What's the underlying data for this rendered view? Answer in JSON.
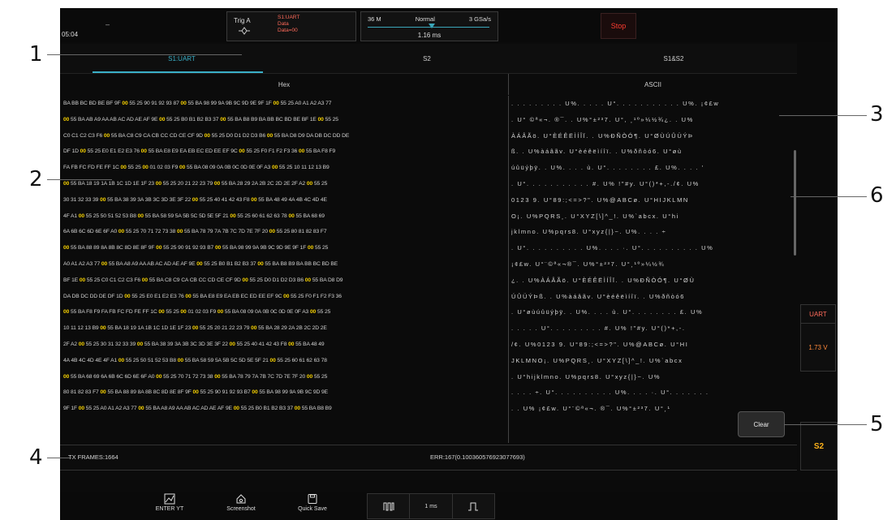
{
  "topbar": {
    "clock": "05:04",
    "left_symbol": "–",
    "trigger": {
      "label": "Trig A",
      "lines": [
        "S1:UART",
        "Data",
        "Data=00"
      ]
    },
    "acquisition": {
      "memory": "36 M",
      "mode": "Normal",
      "rate": "3 GSa/s",
      "timebase": "1.16 ms"
    },
    "stop_label": "Stop"
  },
  "tabs": [
    {
      "label": "S1:UART",
      "active": true
    },
    {
      "label": "S2",
      "active": false
    },
    {
      "label": "S1&S2",
      "active": false
    }
  ],
  "columns": {
    "hex": "Hex",
    "ascii": "ASCII"
  },
  "hex_rows": [
    "BA BB BC BD BE BF 9F 00 55 25 90 91 92 93 87 00 55 BA 98 99 9A 9B 9C 9D 9E 9F 1F 00 55 25 A0 A1 A2 A3 77",
    "00 55 BA AB A9 AA AB AC AD AE AF 9E 00 55 25 B0 B1 B2 B3 37 00 55 BA B8 B9 BA BB BC BD BE BF 1E 00 55 25",
    "C0 C1 C2 C3 F6 00 55 BA C8 C9 CA CB CC CD CE CF 9D 00 55 25 D0 D1 D2 D3 B6 00 55 BA D8 D9 DA DB DC DD DE",
    "DF 1D 00 55 25 E0 E1 E2 E3 76 00 55 BA E8 E9 EA EB EC ED EE EF 9C 00 55 25 F0 F1 F2 F3 36 00 55 BA F8 F9",
    "FA FB FC FD FE FF 1C 00 55 25 00 01 02 03 F9 00 55 BA 08 09 0A 0B 0C 0D 0E 0F A3 00 55 25 10 11 12 13 B9",
    "00 55 BA 18 19 1A 1B 1C 1D 1E 1F 23 00 55 25 20 21 22 23 79 00 55 BA 28 29 2A 2B 2C 2D 2E 2F A2 00 55 25",
    "30 31 32 33 39 00 55 BA 38 39 3A 3B 3C 3D 3E 3F 22 00 55 25 40 41 42 43 F8 00 55 BA 48 49 4A 4B 4C 4D 4E",
    "4F A1 00 55 25 50 51 52 53 B8 00 55 BA 58 59 5A 5B 5C 5D 5E 5F 21 00 55 25 60 61 62 63 78 00 55 BA 68 69",
    "6A 6B 6C 6D 6E 6F A0 00 55 25 70 71 72 73 38 00 55 BA 78 79 7A 7B 7C 7D 7E 7F 20 00 55 25 80 81 82 83 F7",
    "00 55 BA 88 89 8A 8B 8C 8D 8E 8F 9F 00 55 25 90 91 92 93 B7 00 55 BA 98 99 9A 9B 9C 9D 9E 9F 1F 00 55 25",
    "A0 A1 A2 A3 77 00 55 BA A8 A9 AA AB AC AD AE AF 9E 00 55 25 B0 B1 B2 B3 37 00 55 BA B8 B9 BA BB BC BD BE",
    "BF 1E 00 55 25 C0 C1 C2 C3 F6 00 55 BA C8 C9 CA CB CC CD CE CF 9D 00 55 25 D0 D1 D2 D3 B6 00 55 BA D8 D9",
    "DA DB DC DD DE DF 1D 00 55 25 E0 E1 E2 E3 76 00 55 BA E8 E9 EA EB EC ED EE EF 9C 00 55 25 F0 F1 F2 F3 36",
    "00 55 BA F8 F9 FA FB FC FD FE FF 1C 00 55 25 00 01 02 03 F9 00 55 BA 08 09 0A 0B 0C 0D 0E 0F A3 00 55 25",
    "10 11 12 13 B9 00 55 BA 18 19 1A 1B 1C 1D 1E 1F 23 00 55 25 20 21 22 23 79 00 55 BA 28 29 2A 2B 2C 2D 2E",
    "2F A2 00 55 25 30 31 32 33 39 00 55 BA 38 39 3A 3B 3C 3D 3E 3F 22 00 55 25 40 41 42 43 F8 00 55 BA 48 49",
    "4A 4B 4C 4D 4E 4F A1 00 55 25 50 51 52 53 B8 00 55 BA 58 59 5A 5B 5C 5D 5E 5F 21 00 55 25 60 61 62 63 78",
    "00 55 BA 68 69 6A 6B 6C 6D 6E 6F A0 00 55 25 70 71 72 73 38 00 55 BA 78 79 7A 7B 7C 7D 7E 7F 20 00 55 25",
    "80 81 82 83 F7 00 55 BA 88 89 8A 8B 8C 8D 8E 8F 9F 00 55 25 90 91 92 93 B7 00 55 BA 98 99 9A 9B 9C 9D 9E",
    "9F 1F 00 55 25 A0 A1 A2 A3 77 00 55 BA A8 A9 AA AB AC AD AE AF 9E 00 55 25 B0 B1 B2 B3 37 00 55 BA B8 B9"
  ],
  "ascii_rows": [
    ". . . . . . . . . U%. . . . . U°. . . . . . . . . . . U%. ¡¢£w",
    ". U°  ©ª«¬­. ®¯. . U%°±²³7. U°, ¸¹º»¼½¾¿. . U%",
    "ÀÁÂÃö. U°ÈÉÊËÌÍÎÏ. . U%ÐÑÒÓ¶. U°ØÙÚÛÜÝÞ",
    "ß. . U%àáâãv. U°èéêëìíîï. . U%ðñòó6. U°øù",
    "úûüýþÿ. . U%. . . . ù. U°. . . . . . . . £. U%. . . . '",
    ". U°. . . . . . . . . . . #. U% !\"#y. U°()*+,-./¢. U%",
    "0123 9. U°89:;<=>?\". U%@ABCø. U°HIJKLMN",
    "O¡. U%PQRS¸. U°XYZ[\\]^_!. U%`abcx. U°hi",
    "jklmno. U%pqrs8. U°xyz{|}~. U%. . . . ÷",
    ". U°. . . . . . . . . . U%. . . . ·. U°. . . . . . . . . . U%",
    " ¡¢£w. U°¨©ª«¬­®¯. U%°±²³7. U°¸¹º»¼½¾",
    "¿. . U%ÀÁÂÃö. U°ÈÉÊËÌÍÎÏ. . U%ÐÑÒÓ¶. U°ØÙ",
    "ÚÛÜÝÞß. . U%àáâãv. U°èéêëìíîï. . U%ðñòó6",
    ". U°øùúûüýþÿ. . U%. . . . ù. U°. . . . . . . . £. U%",
    ". . . . . U°. . . . . . . . . #. U% !\"#y. U°()*+,-.",
    "/¢. U%0123 9. U°89:;<=>?\". U%@ABCø. U°HI",
    "JKLMNO¡. U%PQRS¸. U°XYZ[\\]^_!. U%`abcx",
    ". U°hijklmno. U%pqrs8. U°xyz{|}~. U%",
    ". . . . ÷. U°. . . . . . . . . . U%. . . . ·. U°. . . . . . .",
    ". . U%  ¡¢£w. U°¨©ª«¬­. ®¯. U%°±²³7. U°¸¹"
  ],
  "clear_label": "Clear",
  "status": {
    "tx_frames": "TX FRAMES:1664",
    "err": "ERR:167(0.100360576923077693)"
  },
  "side": {
    "uart": "UART",
    "voltage": "1.73 V",
    "s2": "S2"
  },
  "toolbar": {
    "enter_yt": "ENTER YT",
    "screenshot": "Screenshot",
    "quick_save": "Quick Save",
    "time": "1 ms"
  },
  "annotations": [
    "1",
    "2",
    "3",
    "4",
    "5",
    "6"
  ],
  "colors": {
    "accent": "#3ab0c8",
    "highlight": "#f5d000",
    "stop": "#ff3b30",
    "uart": "#ff6a5a",
    "s2": "#ffb21a"
  }
}
